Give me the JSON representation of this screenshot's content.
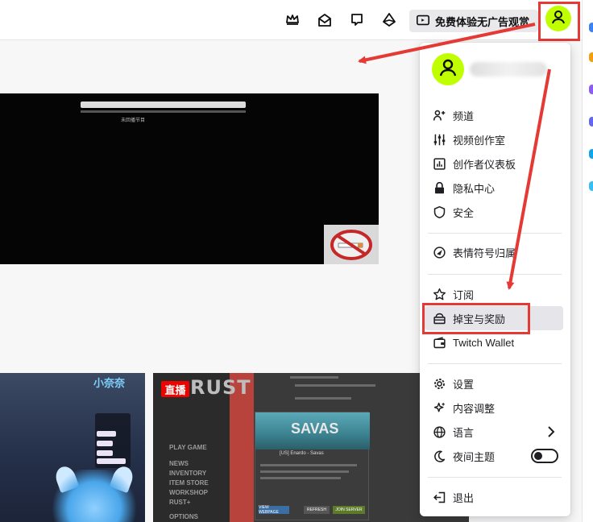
{
  "topbar": {
    "icons": [
      "crown-icon",
      "inbox-icon",
      "whispers-icon",
      "bits-icon"
    ],
    "adfree_label": "免费体验无广告观赏",
    "avatar_icon": "user-icon"
  },
  "colors": {
    "accent_avatar": "#bfff00",
    "annotation_red": "#e53935",
    "live_red": "#eb0400",
    "menu_highlight": "#e6e6ea"
  },
  "video": {
    "center_text": "未回播节目",
    "overlay_icon": "no-smoking-icon"
  },
  "thumbnails": {
    "first_title": "小奈奈",
    "live_badge": "直播",
    "second_game_title": "RUST",
    "second_menu": [
      "PLAY GAME",
      "NEWS",
      "INVENTORY",
      "ITEM STORE",
      "WORKSHOP",
      "RUST+",
      "OPTIONS"
    ],
    "server_name": "SAVAS",
    "server_subtitle": "[US] Enardo - Savas",
    "server_buttons": [
      "VIEW WEBPAGE",
      "REFRESH",
      "JOIN SERVER"
    ]
  },
  "menu": {
    "avatar_icon": "user-icon",
    "items": [
      {
        "label": "频道",
        "icon": "channel-icon"
      },
      {
        "label": "视频创作室",
        "icon": "sliders-icon"
      },
      {
        "label": "创作者仪表板",
        "icon": "dashboard-icon"
      },
      {
        "label": "隐私中心",
        "icon": "lock-icon"
      },
      {
        "label": "安全",
        "icon": "shield-icon"
      },
      {
        "label": "表情符号归属",
        "icon": "emote-icon"
      },
      {
        "label": "订阅",
        "icon": "star-icon"
      },
      {
        "label": "掉宝与奖励",
        "icon": "drops-icon"
      },
      {
        "label": "Twitch Wallet",
        "icon": "wallet-icon"
      },
      {
        "label": "设置",
        "icon": "gear-icon"
      },
      {
        "label": "内容调整",
        "icon": "sparkle-icon"
      },
      {
        "label": "语言",
        "icon": "globe-icon"
      },
      {
        "label": "夜间主题",
        "icon": "moon-icon"
      },
      {
        "label": "退出",
        "icon": "logout-icon"
      }
    ],
    "highlighted_item": "掉宝与奖励",
    "dark_theme_on": false
  }
}
